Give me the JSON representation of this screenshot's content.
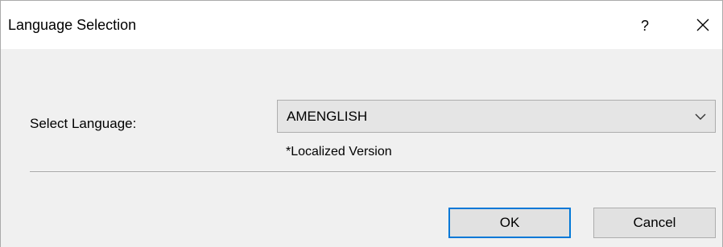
{
  "dialog": {
    "title": "Language Selection",
    "help_label": "?",
    "close_icon": "close-icon"
  },
  "form": {
    "language_label": "Select Language:",
    "language_value": "AMENGLISH",
    "dropdown_icon": "chevron-down-icon",
    "localized_note": "*Localized Version"
  },
  "buttons": {
    "ok_label": "OK",
    "cancel_label": "Cancel"
  },
  "colors": {
    "focus_border": "#0078d7",
    "dialog_background": "#f0f0f0",
    "titlebar_background": "#ffffff"
  }
}
